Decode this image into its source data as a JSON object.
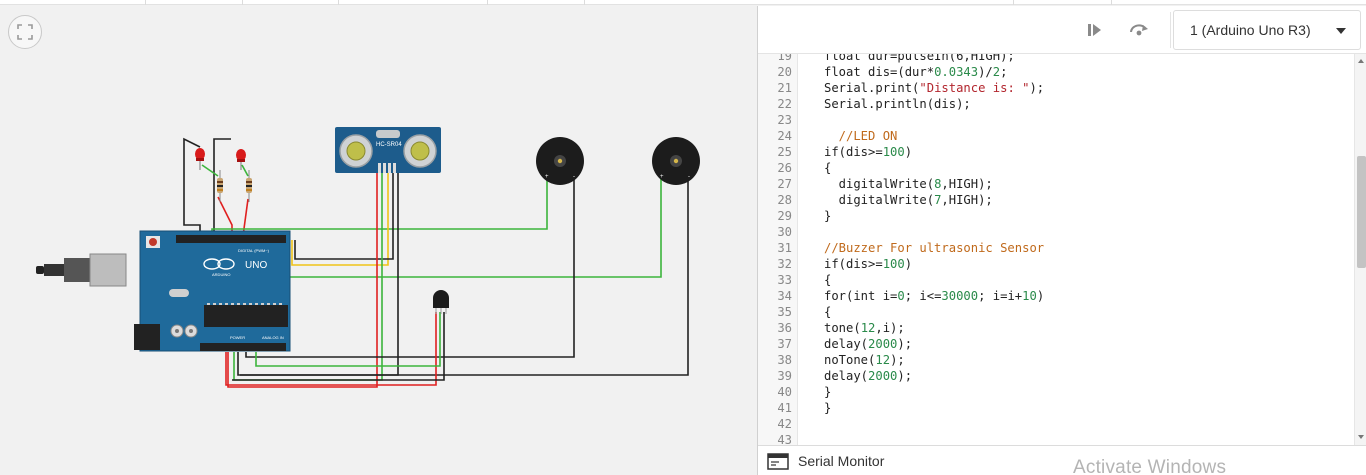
{
  "toolbar": {
    "device_selected": "1 (Arduino Uno R3)",
    "icons": [
      "step-forward-icon",
      "restart-icon",
      "fit-view-icon"
    ]
  },
  "circuit": {
    "sensor_label": "HC-SR04",
    "board_brand": "UNO",
    "board_maker": "ARDUINO",
    "header_labels": [
      "DIGITAL (PWM~)",
      "POWER",
      "ANALOG IN"
    ],
    "colors": {
      "red": "#e02020",
      "green": "#3cb53c",
      "yellow": "#f0c419",
      "black": "#222222",
      "board": "#1f6a9b"
    }
  },
  "editor": {
    "lines": [
      {
        "n": "19",
        "segs": [
          [
            "float dur=pulseIn(6,HIGH);",
            ""
          ]
        ]
      },
      {
        "n": "20",
        "segs": [
          [
            "float dis=(dur*",
            ""
          ],
          [
            "0.0343",
            "num"
          ],
          [
            ")/",
            ""
          ],
          [
            "2",
            "num"
          ],
          [
            ";",
            ""
          ]
        ]
      },
      {
        "n": "21",
        "segs": [
          [
            "Serial.print(",
            ""
          ],
          [
            "\"Distance is: \"",
            "str"
          ],
          [
            ");",
            ""
          ]
        ]
      },
      {
        "n": "22",
        "segs": [
          [
            "Serial.println(dis);",
            ""
          ]
        ]
      },
      {
        "n": "23",
        "segs": []
      },
      {
        "n": "24",
        "segs": [
          [
            "  //LED ON",
            "cmt"
          ]
        ]
      },
      {
        "n": "25",
        "segs": [
          [
            "if(dis>=",
            ""
          ],
          [
            "100",
            "num"
          ],
          [
            ")",
            ""
          ]
        ]
      },
      {
        "n": "26",
        "segs": [
          [
            "{",
            ""
          ]
        ]
      },
      {
        "n": "27",
        "segs": [
          [
            "  digitalWrite(",
            ""
          ],
          [
            "8",
            "num"
          ],
          [
            ",HIGH);",
            ""
          ]
        ]
      },
      {
        "n": "28",
        "segs": [
          [
            "  digitalWrite(",
            ""
          ],
          [
            "7",
            "num"
          ],
          [
            ",HIGH);",
            ""
          ]
        ]
      },
      {
        "n": "29",
        "segs": [
          [
            "}",
            ""
          ]
        ]
      },
      {
        "n": "30",
        "segs": []
      },
      {
        "n": "31",
        "segs": [
          [
            "//Buzzer For ultrasonic Sensor",
            "cmt"
          ]
        ]
      },
      {
        "n": "32",
        "segs": [
          [
            "if(dis>=",
            ""
          ],
          [
            "100",
            "num"
          ],
          [
            ")",
            ""
          ]
        ]
      },
      {
        "n": "33",
        "segs": [
          [
            "{",
            ""
          ]
        ]
      },
      {
        "n": "34",
        "segs": [
          [
            "for(int i=",
            ""
          ],
          [
            "0",
            "num"
          ],
          [
            "; i<=",
            ""
          ],
          [
            "30000",
            "num"
          ],
          [
            "; i=i+",
            ""
          ],
          [
            "10",
            "num"
          ],
          [
            ")",
            ""
          ]
        ]
      },
      {
        "n": "35",
        "segs": [
          [
            "{",
            ""
          ]
        ]
      },
      {
        "n": "36",
        "segs": [
          [
            "tone(",
            ""
          ],
          [
            "12",
            "num"
          ],
          [
            ",i);",
            ""
          ]
        ]
      },
      {
        "n": "37",
        "segs": [
          [
            "delay(",
            ""
          ],
          [
            "2000",
            "num"
          ],
          [
            ");",
            ""
          ]
        ]
      },
      {
        "n": "38",
        "segs": [
          [
            "noTone(",
            ""
          ],
          [
            "12",
            "num"
          ],
          [
            ");",
            ""
          ]
        ]
      },
      {
        "n": "39",
        "segs": [
          [
            "delay(",
            ""
          ],
          [
            "2000",
            "num"
          ],
          [
            ");",
            ""
          ]
        ]
      },
      {
        "n": "40",
        "segs": [
          [
            "}",
            ""
          ]
        ]
      },
      {
        "n": "41",
        "segs": [
          [
            "}",
            ""
          ]
        ]
      },
      {
        "n": "42",
        "segs": []
      },
      {
        "n": "43",
        "segs": []
      }
    ]
  },
  "serial_monitor": {
    "label": "Serial Monitor"
  },
  "watermark": "Activate Windows"
}
